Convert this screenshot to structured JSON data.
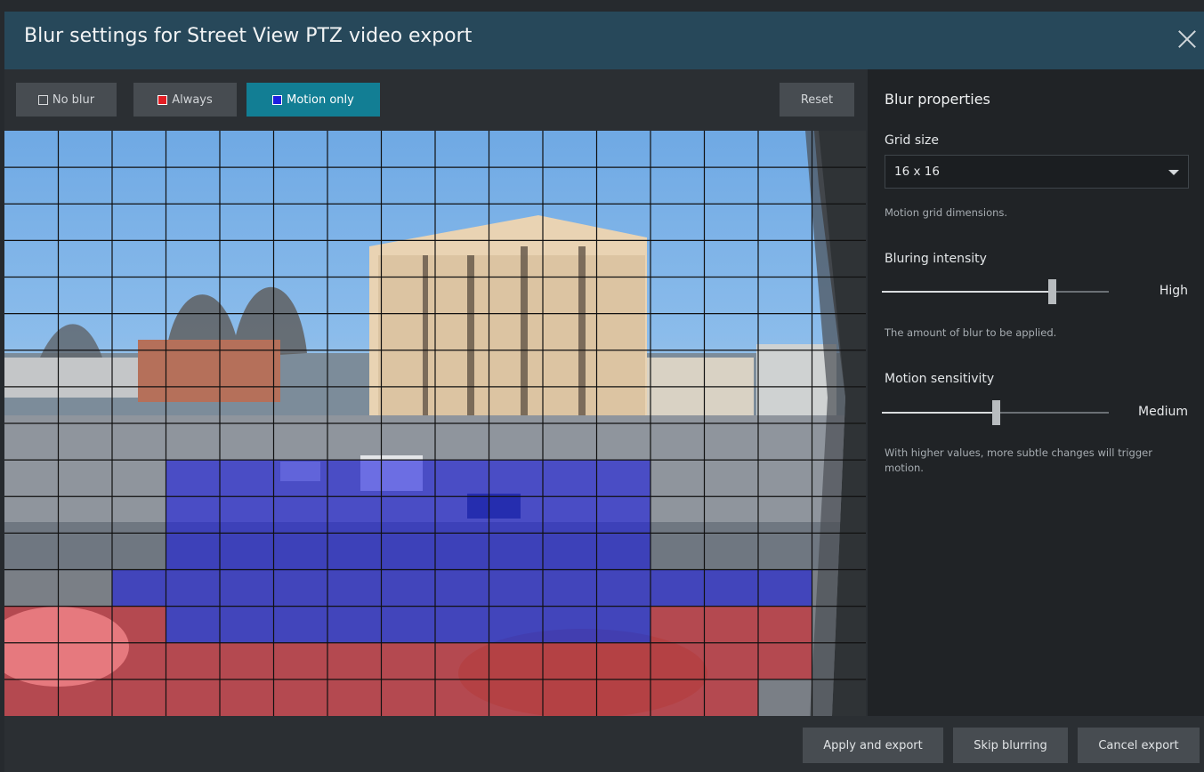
{
  "window": {
    "title": "Blur settings for Street View PTZ video export"
  },
  "toolbar": {
    "no_blur": "No blur",
    "always": "Always",
    "motion_only": "Motion only",
    "reset": "Reset",
    "active_mode": "motion_only"
  },
  "colors": {
    "accent": "#127e94",
    "titlebar": "#27485a",
    "always_blur": "#e31e24",
    "motion_blur": "#1d1ee0"
  },
  "properties": {
    "heading": "Blur properties",
    "grid_size": {
      "label": "Grid size",
      "value": "16 x 16",
      "help": "Motion grid dimensions."
    },
    "blur_intensity": {
      "label": "Bluring intensity",
      "value_text": "High",
      "level": 0.75,
      "help": "The amount of blur to be applied."
    },
    "motion_sensitivity": {
      "label": "Motion sensitivity",
      "value_text": "Medium",
      "level": 0.5,
      "help": "With higher values, more subtle changes will trigger motion."
    }
  },
  "grid": {
    "columns": 16,
    "rows": 16,
    "cells": [
      "0000000000000000",
      "0000000000000000",
      "0000000000000000",
      "0000000000000000",
      "0000000000000000",
      "0000000000000000",
      "0000000000000000",
      "0000000000000000",
      "0000000000000000",
      "0003333333330000",
      "0003333333330000",
      "0003333333330000",
      "0033333333333330",
      "2223333333332220",
      "2222222222222220",
      "2222222222222200"
    ]
  },
  "footer": {
    "apply": "Apply and export",
    "skip": "Skip blurring",
    "cancel": "Cancel export"
  }
}
